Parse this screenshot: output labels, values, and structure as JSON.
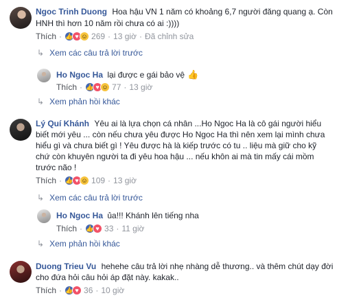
{
  "comments": [
    {
      "author": "Ngoc Trinh Duong",
      "lines": [
        "Hoa hậu VN 1 năm có khoảng 6,7 người đăng quang ạ. Còn",
        "HNH thì hơn 10 năm rồi chưa có ai :))))"
      ],
      "like_label": "Thích",
      "reactions": "269",
      "time": "13 giờ",
      "edited": "Đã chỉnh sửa",
      "replies_link": "Xem các câu trả lời trước"
    },
    {
      "author": "Ho Ngoc Ha",
      "text": "lại được e gái bảo vệ",
      "like_label": "Thích",
      "reactions": "77",
      "time": "13 giờ",
      "more_link": "Xem phản hồi khác"
    },
    {
      "author": "Lý Quí Khánh",
      "lines": [
        "Yêu ai là lựa chọn cá nhân ...Ho Ngoc Ha là cô gái người hiểu",
        "biết mới yêu ... còn nếu chưa yêu được Ho Ngoc Ha thì nên xem lại mình chưa",
        "hiểu gì và chưa biết gì ! Yêu được hà là kiếp trước có tu .. liệu mà giữ cho kỹ",
        "chứ còn khuyên người ta đi yêu hoa hậu ... nếu khôn ai mà tin mấy cái mồm",
        "trước não !"
      ],
      "like_label": "Thích",
      "reactions": "109",
      "time": "13 giờ",
      "replies_link": "Xem các câu trả lời trước"
    },
    {
      "author": "Ho Ngoc Ha",
      "text": "ủa!!! Khánh lên tiếng nha",
      "like_label": "Thích",
      "reactions": "33",
      "time": "11 giờ",
      "more_link": "Xem phản hồi khác"
    },
    {
      "author": "Duong Trieu Vu",
      "lines": [
        "hehehe câu trả lời nhẹ nhàng dễ thương.. và thêm chút dạy đời",
        "cho đứa hỏi câu hỏi áp đặt này. kakak.."
      ],
      "like_label": "Thích",
      "reactions": "36",
      "time": "10 giờ"
    }
  ],
  "colors": {
    "author": "#365899",
    "meta": "#90949c",
    "like": "#4267b2",
    "love": "#f25268",
    "haha": "#f7c33c"
  }
}
